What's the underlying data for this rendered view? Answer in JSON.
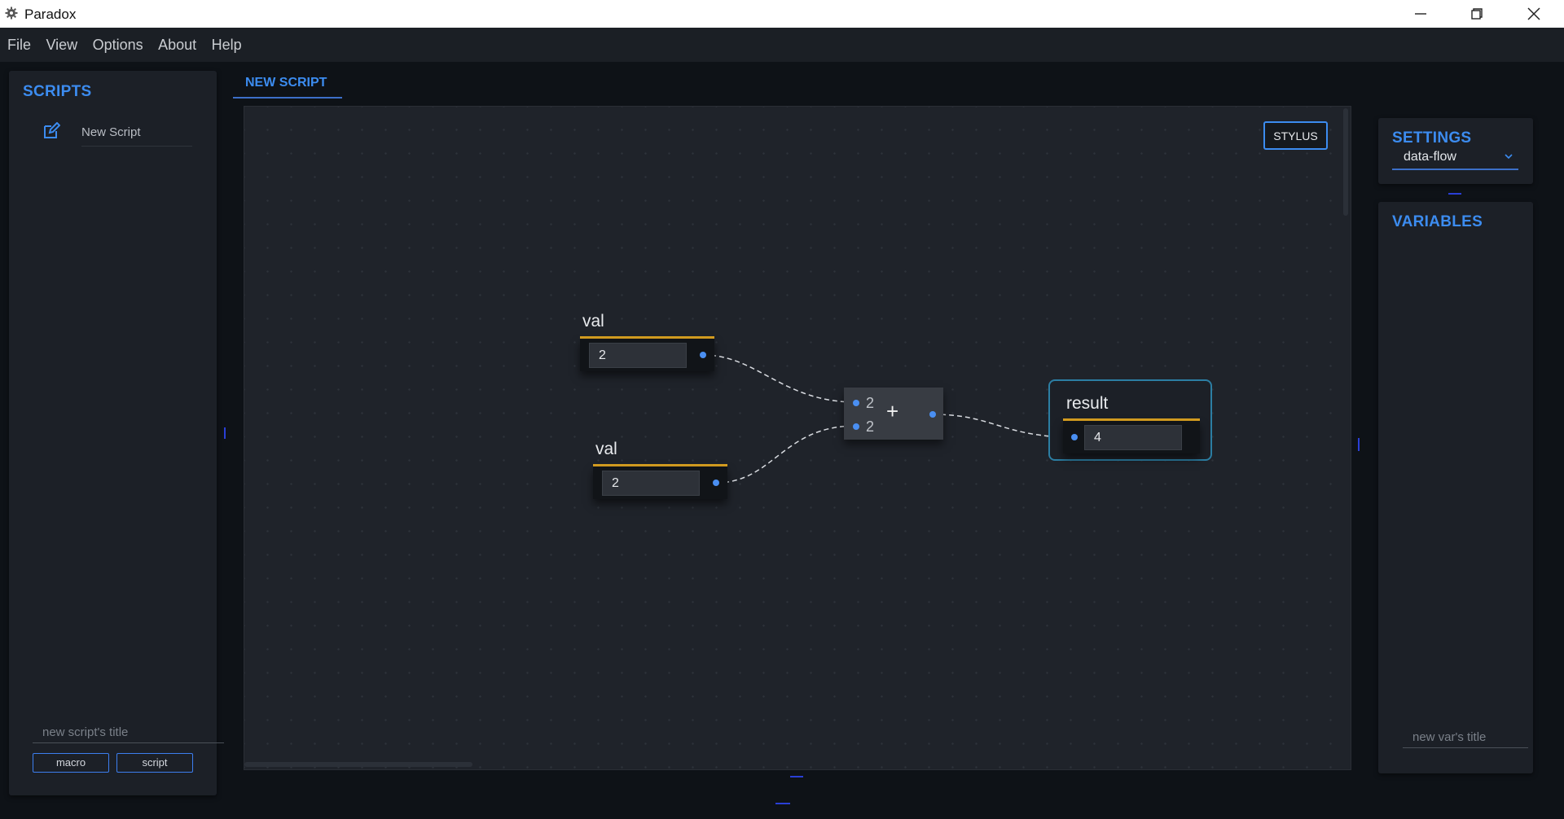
{
  "window": {
    "title": "Paradox"
  },
  "menu": [
    "File",
    "View",
    "Options",
    "About",
    "Help"
  ],
  "scripts_panel": {
    "title": "SCRIPTS",
    "items": [
      {
        "label": "New Script"
      }
    ],
    "new_title_placeholder": "new script's title",
    "buttons": {
      "macro": "macro",
      "script": "script"
    }
  },
  "editor": {
    "tabs": [
      {
        "label": "NEW SCRIPT",
        "active": true
      }
    ],
    "stylus_label": "STYLUS",
    "nodes": {
      "val1": {
        "title": "val",
        "value": "2"
      },
      "val2": {
        "title": "val",
        "value": "2"
      },
      "add": {
        "operator": "+",
        "inputs": [
          "2",
          "2"
        ]
      },
      "result": {
        "title": "result",
        "value": "4"
      }
    }
  },
  "settings_panel": {
    "title": "SETTINGS",
    "mode": "data-flow"
  },
  "variables_panel": {
    "title": "VARIABLES",
    "new_var_placeholder": "new var's title"
  },
  "colors": {
    "accent": "#3c8cf0",
    "node_bar": "#d9a021",
    "port": "#4a8ff2",
    "result_border": "#2c7ea3",
    "background": "#0e1217"
  },
  "icons": [
    "gear-icon",
    "minimize-icon",
    "restore-icon",
    "close-icon",
    "edit-icon",
    "chevron-down-icon"
  ]
}
